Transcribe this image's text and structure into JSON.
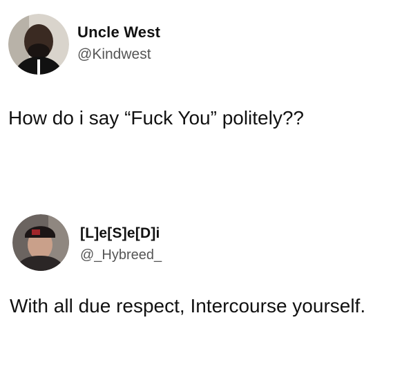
{
  "tweets": [
    {
      "display_name": "Uncle West",
      "handle": "@Kindwest",
      "text": "How do i say “Fuck You” politely??",
      "avatar_icon": "profile-photo-avatar"
    },
    {
      "display_name": "[L]e[S]e[D]i",
      "handle": "@_Hybreed_",
      "text": "With all due respect, Intercourse yourself.",
      "avatar_icon": "profile-photo-avatar"
    }
  ]
}
